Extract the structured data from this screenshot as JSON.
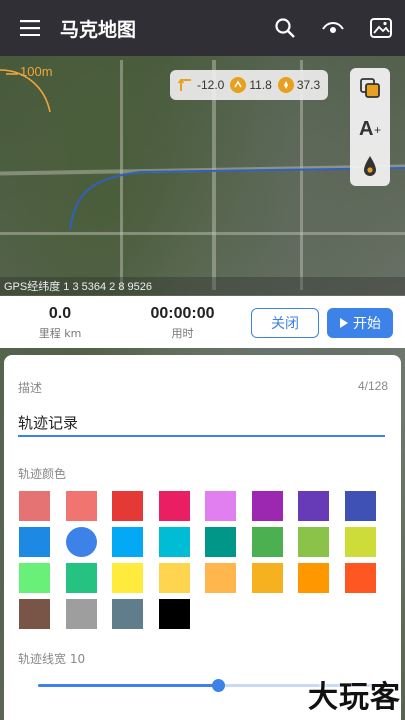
{
  "appbar": {
    "title": "马克地图",
    "icons": [
      "menu-icon",
      "search-icon",
      "eye-icon",
      "image-edit-icon"
    ]
  },
  "map": {
    "scale_label": "100m",
    "sensors": {
      "altitude": "-12.0",
      "speed": "11.8",
      "heading": "37.3"
    },
    "tools": [
      "layers-icon",
      "text-size-icon",
      "location-pin-icon"
    ],
    "gps_text": "GPS经纬度  1  3  5364    2  8  9526"
  },
  "stats": {
    "distance_value": "0.0",
    "distance_label": "里程 km",
    "time_value": "00:00:00",
    "time_label": "用时",
    "close_label": "关闭",
    "start_label": "开始"
  },
  "sheet": {
    "desc_label": "描述",
    "desc_count": "4/128",
    "desc_value": "轨迹记录",
    "color_label": "轨迹颜色",
    "swatches": [
      "#e57373",
      "#f07470",
      "#e53935",
      "#e91e63",
      "#e17ef0",
      "#9c27b0",
      "#673ab7",
      "#3f51b5",
      "#1e88e5",
      "#3d82e8",
      "#03a9f4",
      "#00bcd4",
      "#009688",
      "#4caf50",
      "#8bc34a",
      "#cddc39",
      "#69f079",
      "#26c281",
      "#ffeb3b",
      "#ffd54f",
      "#ffb74d",
      "#f5b120",
      "#ff9800",
      "#ff5722",
      "#795548",
      "#9e9e9e",
      "#607d8b",
      "#000000"
    ],
    "selected_swatch": 9,
    "width_label": "轨迹线宽 10",
    "width_value": 0.53
  },
  "watermark": "大玩客",
  "colors": {
    "accent": "#3d82e8",
    "appbar": "#2f2f35",
    "scale": "#f0a53a"
  }
}
